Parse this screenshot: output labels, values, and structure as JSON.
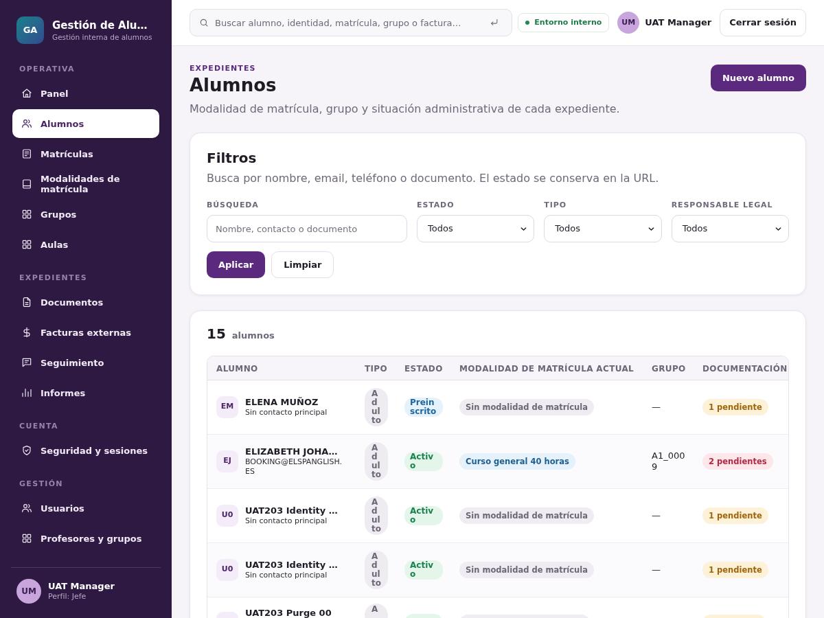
{
  "sidebar": {
    "logo": {
      "initials": "GA"
    },
    "title": "Gestión de Alu…",
    "subtitle": "Gestión interna de alumnos",
    "sections": [
      {
        "label": "OPERATIVA",
        "items": [
          {
            "label": "Panel",
            "selected": false
          },
          {
            "label": "Alumnos",
            "selected": true
          },
          {
            "label": "Matrículas",
            "selected": false
          },
          {
            "label": "Modalidades de matrícula",
            "selected": false
          },
          {
            "label": "Grupos",
            "selected": false
          },
          {
            "label": "Aulas",
            "selected": false
          }
        ]
      },
      {
        "label": "EXPEDIENTES",
        "items": [
          {
            "label": "Documentos",
            "selected": false
          },
          {
            "label": "Facturas externas",
            "selected": false
          },
          {
            "label": "Seguimiento",
            "selected": false
          },
          {
            "label": "Informes",
            "selected": false
          }
        ]
      },
      {
        "label": "CUENTA",
        "items": [
          {
            "label": "Seguridad y sesiones",
            "selected": false
          }
        ]
      },
      {
        "label": "GESTIÓN",
        "items": [
          {
            "label": "Usuarios",
            "selected": false
          },
          {
            "label": "Profesores y grupos",
            "selected": false
          }
        ]
      }
    ],
    "user": {
      "initials": "UM",
      "name": "UAT Manager",
      "role": "Perfil: Jefe"
    }
  },
  "header": {
    "search": {
      "placeholder": "Buscar alumno, identidad, matrícula, grupo o factura…"
    },
    "environment": "Entorno interno",
    "user": {
      "initials": "UM",
      "name": "UAT Manager"
    },
    "logout": "Cerrar sesión"
  },
  "page": {
    "eyebrow": "EXPEDIENTES",
    "title": "Alumnos",
    "subtitle": "Modalidad de matrícula, grupo y situación administrativa de cada expediente.",
    "primary_button": "Nuevo alumno"
  },
  "filters": {
    "title": "Filtros",
    "description": "Busca por nombre, email, teléfono o documento. El estado se conserva en la URL.",
    "fields": [
      {
        "kind": "text",
        "label": "BÚSQUEDA",
        "placeholder": "Nombre, contacto o documento"
      },
      {
        "kind": "select",
        "label": "ESTADO",
        "value": "Todos"
      },
      {
        "kind": "select",
        "label": "TIPO",
        "value": "Todos"
      },
      {
        "kind": "select",
        "label": "RESPONSABLE LEGAL",
        "value": "Todos"
      }
    ],
    "buttons": [
      {
        "label": "Aplicar",
        "kind": "primary"
      },
      {
        "label": "Limpiar",
        "kind": "secondary"
      }
    ]
  },
  "results": {
    "count": "15",
    "count_label": "alumnos",
    "table": {
      "columns": [
        "ALUMNO",
        "TIPO",
        "ESTADO",
        "MODALIDAD DE MATRÍCULA ACTUAL",
        "GRUPO",
        "DOCUMENTACIÓN"
      ],
      "rows": [
        {
          "initials": "EM",
          "name": "ELENA MUÑOZ",
          "contact": "Sin contacto principal",
          "type": "Adulto",
          "status": {
            "text": "Preinscrito",
            "kind": "pre"
          },
          "modality": {
            "text": "Sin modalidad de matrícula",
            "kind": "none"
          },
          "group": "—",
          "documentation": {
            "text": "1 pendiente",
            "kind": "warning"
          }
        },
        {
          "initials": "EJ",
          "name": "ELIZABETH JOHA…",
          "contact": "BOOKING@ELSPANGLISH.ES",
          "type": "Adulto",
          "status": {
            "text": "Activo",
            "kind": "active"
          },
          "modality": {
            "text": "Curso general 40 horas",
            "kind": "course"
          },
          "group": "A1_0009",
          "documentation": {
            "text": "2 pendientes",
            "kind": "danger"
          }
        },
        {
          "initials": "U0",
          "name": "UAT203 Identity …",
          "contact": "Sin contacto principal",
          "type": "Adulto",
          "status": {
            "text": "Activo",
            "kind": "active"
          },
          "modality": {
            "text": "Sin modalidad de matrícula",
            "kind": "none"
          },
          "group": "—",
          "documentation": {
            "text": "1 pendiente",
            "kind": "warning"
          }
        },
        {
          "initials": "U0",
          "name": "UAT203 Identity …",
          "contact": "Sin contacto principal",
          "type": "Adulto",
          "status": {
            "text": "Activo",
            "kind": "active"
          },
          "modality": {
            "text": "Sin modalidad de matrícula",
            "kind": "none"
          },
          "group": "—",
          "documentation": {
            "text": "1 pendiente",
            "kind": "warning"
          }
        },
        {
          "cut": true,
          "name": "UAT203 Purge 00",
          "type": "A",
          "status": {
            "kind": "active"
          },
          "modality": {
            "kind": "none"
          },
          "documentation": {
            "kind": "warning"
          }
        }
      ]
    }
  }
}
